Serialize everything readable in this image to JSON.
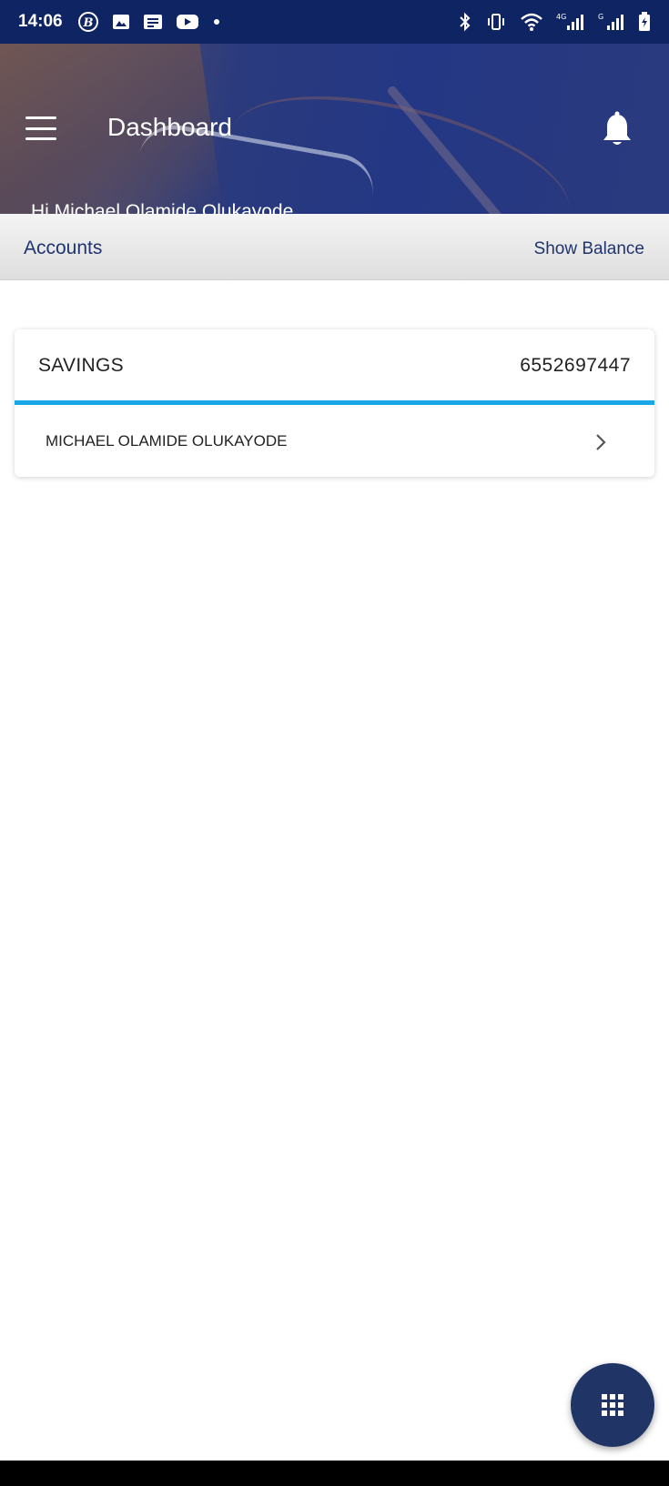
{
  "status_bar": {
    "time": "14:06",
    "left_icons": [
      "b-circle-icon",
      "image-icon",
      "news-icon",
      "youtube-icon",
      "dot-icon"
    ],
    "right_icons": [
      "bluetooth-icon",
      "vibrate-icon",
      "wifi-icon",
      "signal-4g-icon",
      "signal-icon",
      "battery-charging-icon"
    ],
    "network_label_1": "4G",
    "network_label_2": "G"
  },
  "header": {
    "title": "Dashboard",
    "greeting": "Hi Michael Olamide Olukayode",
    "menu_icon": "hamburger-menu-icon",
    "notification_icon": "bell-icon"
  },
  "accounts_bar": {
    "title": "Accounts",
    "show_balance_label": "Show Balance"
  },
  "account_card": {
    "type": "SAVINGS",
    "number": "6552697447",
    "holder_name": "MICHAEL OLAMIDE OLUKAYODE",
    "accent_color": "#1aa7e8"
  },
  "fab": {
    "icon": "apps-grid-icon"
  },
  "colors": {
    "status_bar": "#0f2463",
    "primary": "#1f3470",
    "fab": "#203466"
  }
}
